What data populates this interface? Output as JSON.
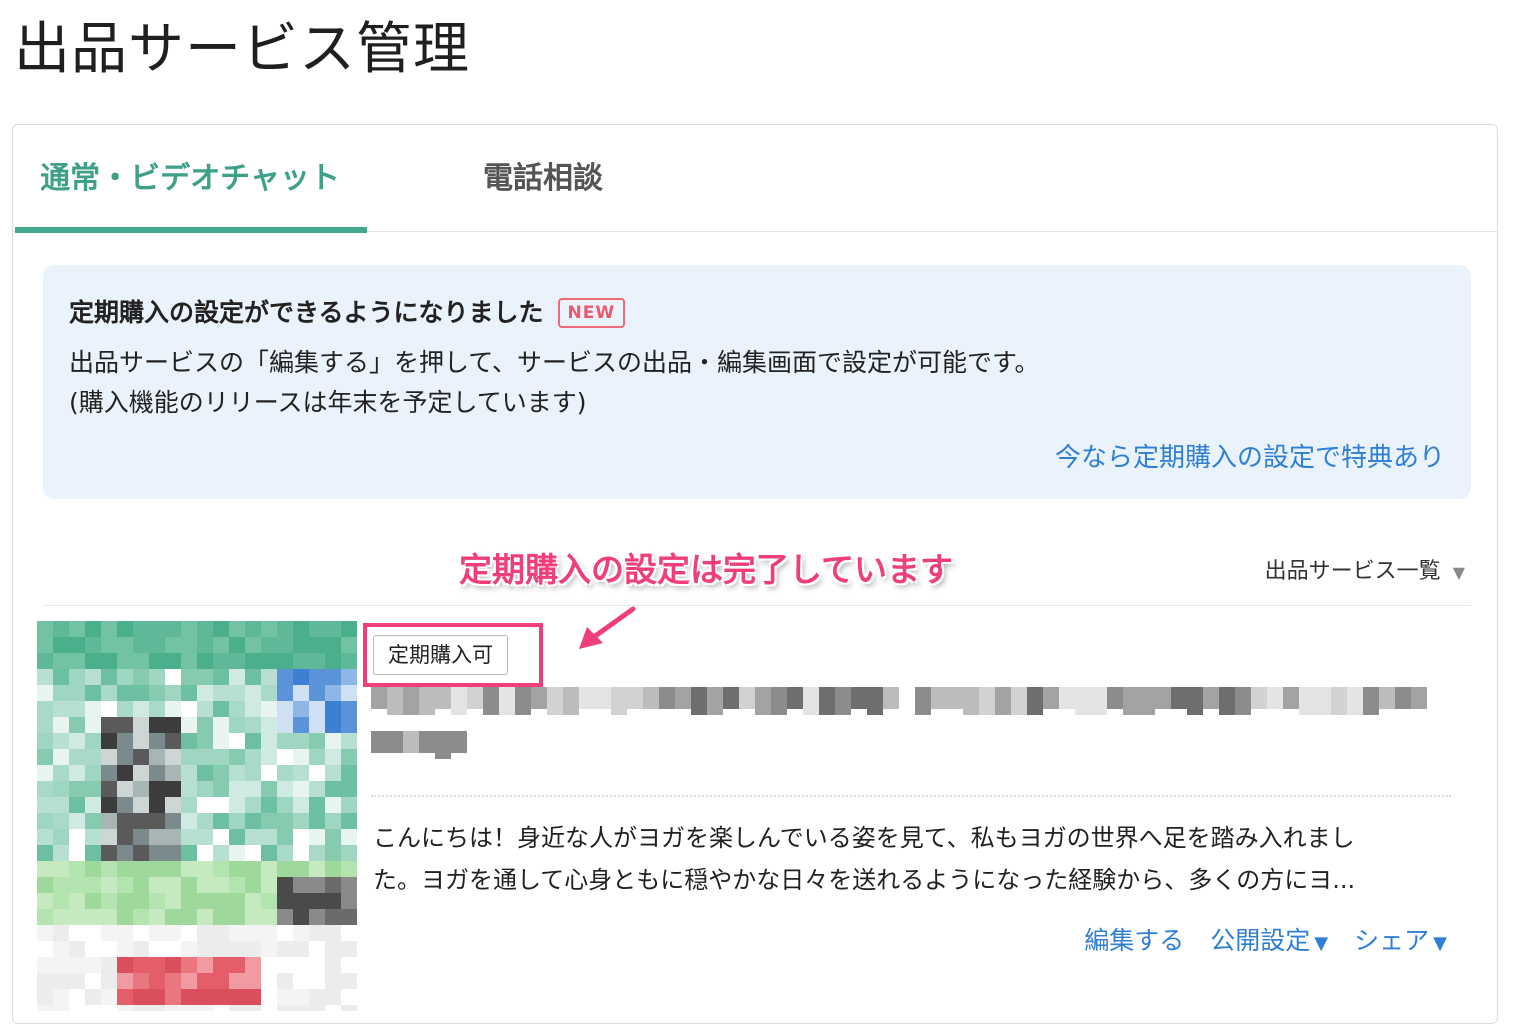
{
  "page": {
    "title": "出品サービス管理"
  },
  "tabs": [
    {
      "label": "通常・ビデオチャット",
      "active": true
    },
    {
      "label": "電話相談",
      "active": false
    }
  ],
  "notice": {
    "title": "定期購入の設定ができるようになりました",
    "badge": "NEW",
    "line1": "出品サービスの「編集する」を押して、サービスの出品・編集画面で設定が可能です。",
    "line2": "(購入機能のリリースは年末を予定しています)",
    "link": "今なら定期購入の設定で特典あり"
  },
  "annotation": {
    "text": "定期購入の設定は完了しています",
    "color": "#ef3f78"
  },
  "list_dropdown": {
    "label": "出品サービス一覧",
    "caret": "▼"
  },
  "service": {
    "tag": "定期購入可",
    "description_line1": "こんにちは！身近な人がヨガを楽しんでいる姿を見て、私もヨガの世界へ足を踏み入れまし",
    "description_line2": "た。ヨガを通して心身ともに穏やかな日々を送れるようになった経験から、多くの方にヨ...",
    "actions": {
      "edit": "編集する",
      "publish": "公開設定",
      "share": "シェア",
      "caret": "▼"
    }
  },
  "colors": {
    "accent_green": "#47a78c",
    "link_blue": "#2f7fd6",
    "notice_bg": "#eaf3fc",
    "highlight_pink": "#ee3f78"
  }
}
